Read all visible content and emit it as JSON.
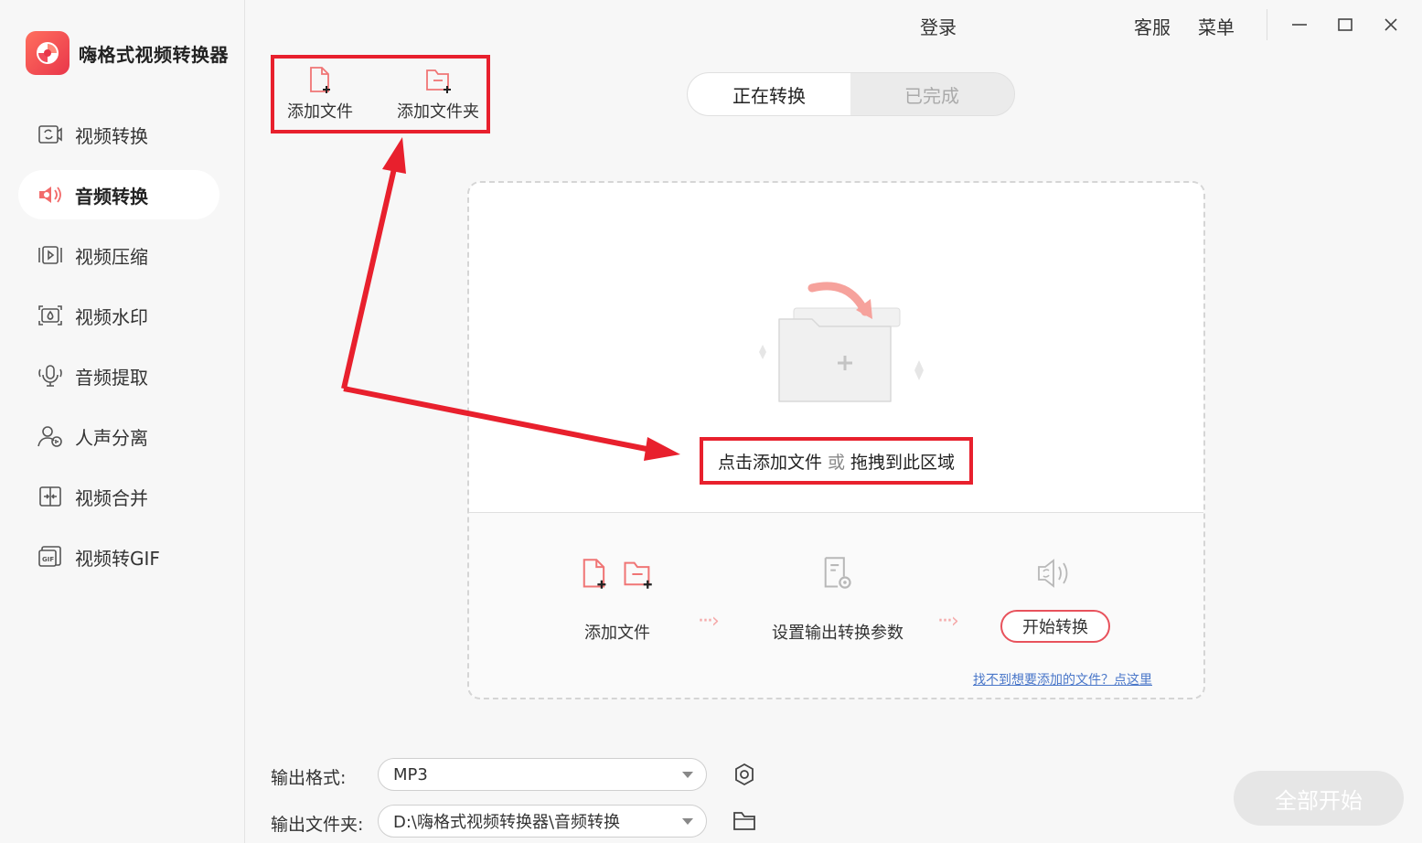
{
  "app": {
    "name": "嗨格式视频转换器",
    "accent_color": "#e8364a"
  },
  "sidebar": {
    "items": [
      {
        "label": "视频转换",
        "icon": "video-convert-icon"
      },
      {
        "label": "音频转换",
        "icon": "audio-convert-icon",
        "active": true
      },
      {
        "label": "视频压缩",
        "icon": "video-compress-icon"
      },
      {
        "label": "视频水印",
        "icon": "video-watermark-icon"
      },
      {
        "label": "音频提取",
        "icon": "audio-extract-icon"
      },
      {
        "label": "人声分离",
        "icon": "voice-separate-icon"
      },
      {
        "label": "视频合并",
        "icon": "video-merge-icon"
      },
      {
        "label": "视频转GIF",
        "icon": "video-to-gif-icon"
      }
    ]
  },
  "topbar": {
    "login": "登录",
    "service": "客服",
    "menu": "菜单"
  },
  "toolbar": {
    "add_file": "添加文件",
    "add_folder": "添加文件夹"
  },
  "tabs": {
    "converting": "正在转换",
    "completed": "已完成"
  },
  "dropzone": {
    "hint_click": "点击添加文件",
    "hint_or": "或",
    "hint_drag": "拖拽到此区域",
    "step1": "添加文件",
    "step2": "设置输出转换参数",
    "step3_button": "开始转换",
    "help_link": "找不到想要添加的文件？点这里"
  },
  "bottom": {
    "format_label": "输出格式:",
    "format_value": "MP3",
    "folder_label": "输出文件夹:",
    "folder_value": "D:\\嗨格式视频转换器\\音频转换",
    "start_all": "全部开始"
  }
}
